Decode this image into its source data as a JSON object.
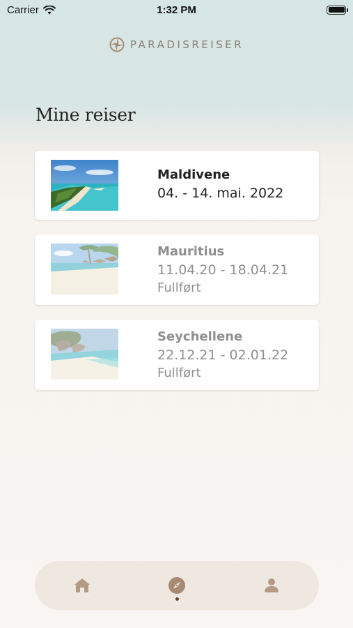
{
  "status_bar": {
    "carrier": "Carrier",
    "time": "1:32 PM"
  },
  "brand": {
    "name": "PARADISREISER",
    "logo_icon": "ship-wheel-icon"
  },
  "page": {
    "title": "Mine reiser"
  },
  "trips": [
    {
      "name": "Maldivene",
      "dates": "04. - 14. mai. 2022",
      "status": "",
      "image": "maldives-beach-photo"
    },
    {
      "name": "Mauritius",
      "dates": "11.04.20 - 18.04.21",
      "status": "Fullført",
      "image": "mauritius-beach-photo"
    },
    {
      "name": "Seychellene",
      "dates": "22.12.21 - 02.01.22",
      "status": "Fullført",
      "image": "seychelles-beach-photo"
    }
  ],
  "tab_bar": {
    "tabs": [
      {
        "icon": "home-icon",
        "active": false
      },
      {
        "icon": "compass-icon",
        "active": true
      },
      {
        "icon": "person-icon",
        "active": false
      }
    ]
  },
  "colors": {
    "accent": "#a88a72",
    "header_bg": "#d6e6e6",
    "body_bg": "#f8f5f2",
    "tab_bar_bg": "#efe8e0"
  }
}
